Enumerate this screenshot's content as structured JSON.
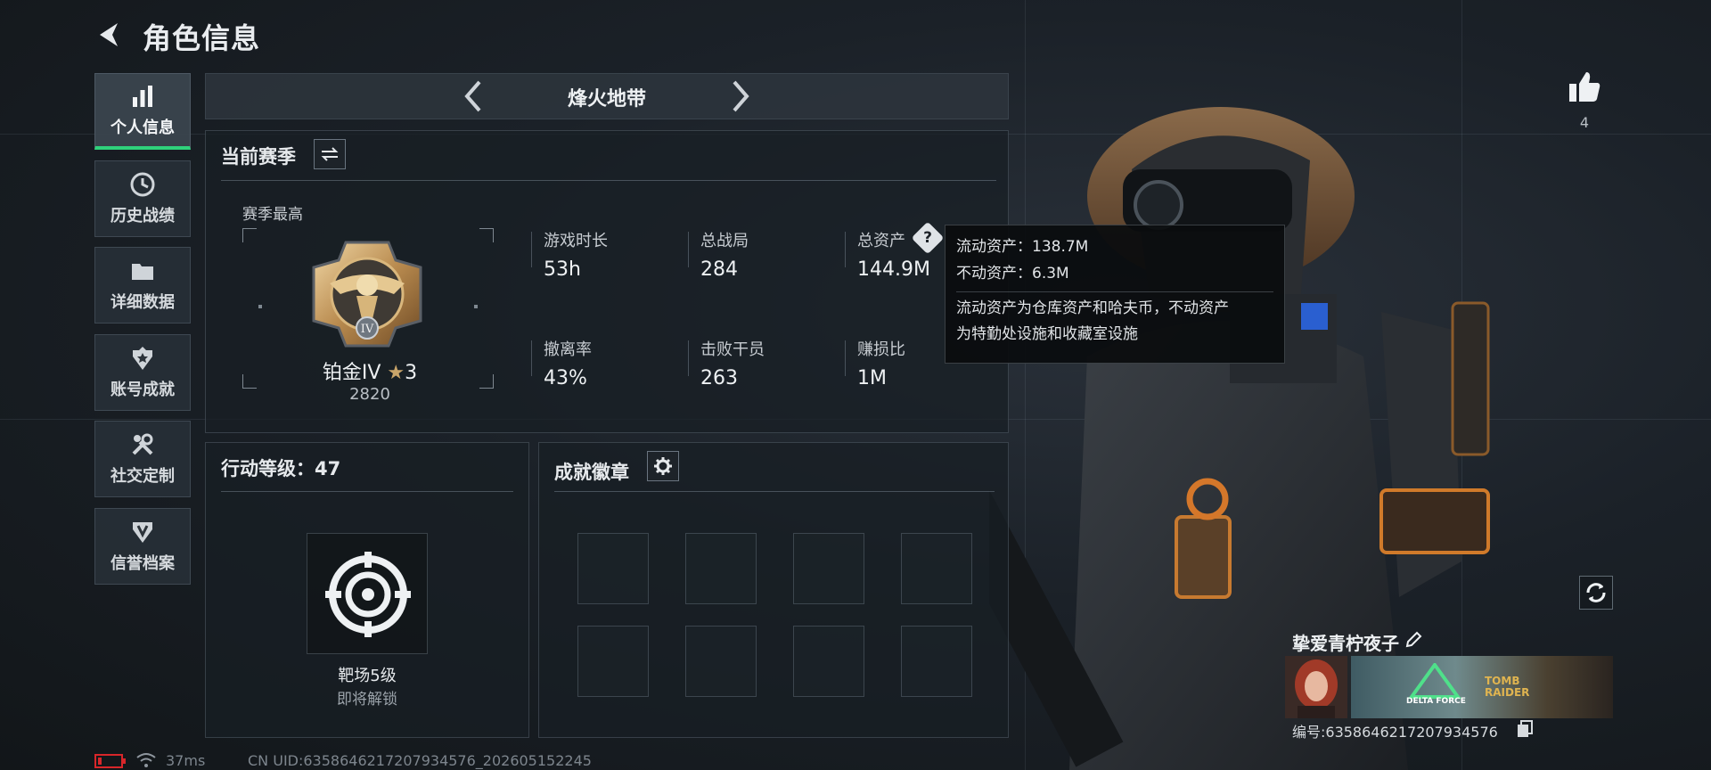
{
  "header": {
    "title": "角色信息"
  },
  "nav": {
    "items": [
      {
        "label": "个人信息",
        "icon": "bar-chart-icon",
        "active": true
      },
      {
        "label": "历史战绩",
        "icon": "clock-icon",
        "active": false
      },
      {
        "label": "详细数据",
        "icon": "folder-icon",
        "active": false
      },
      {
        "label": "账号成就",
        "icon": "medal-icon",
        "active": false
      },
      {
        "label": "社交定制",
        "icon": "wrench-icon",
        "active": false
      },
      {
        "label": "信誉档案",
        "icon": "shield-icon",
        "active": false
      }
    ]
  },
  "mode": {
    "title": "烽火地带"
  },
  "season": {
    "title": "当前赛季",
    "best_label": "赛季最高",
    "rank_name": "铂金IV",
    "rank_stars": "3",
    "rank_score": "2820",
    "emblem_numeral": "IV",
    "stats": [
      {
        "label": "游戏时长",
        "value": "53h"
      },
      {
        "label": "总战局",
        "value": "284"
      },
      {
        "label": "总资产",
        "value": "144.9M"
      },
      {
        "label": "撤离率",
        "value": "43%"
      },
      {
        "label": "击败干员",
        "value": "263"
      },
      {
        "label": "赚损比",
        "value": "1M"
      }
    ]
  },
  "tooltip": {
    "line1": "流动资产：138.7M",
    "line2": "不动资产：6.3M",
    "line3": "流动资产为仓库资产和哈夫币，不动资产",
    "line4": "为特勤处设施和收藏室设施"
  },
  "action_level": {
    "title": "行动等级：47",
    "unlock_name": "靶场5级",
    "unlock_status": "即将解锁"
  },
  "achievements": {
    "title": "成就徽章"
  },
  "likes": {
    "count": "4"
  },
  "profile": {
    "name": "挚爱青柠夜子",
    "id_text": "编号:6358646217207934576",
    "banner_text_1": "DELTA FORCE",
    "banner_text_2": "TOMB RAIDER"
  },
  "status_bar": {
    "ping": "37ms",
    "uid": "CN UID:6358646217207934576_202605152245"
  },
  "colors": {
    "accent": "#2fd27b",
    "battery": "#d8262a",
    "rank_gold": "#c9a56a"
  }
}
